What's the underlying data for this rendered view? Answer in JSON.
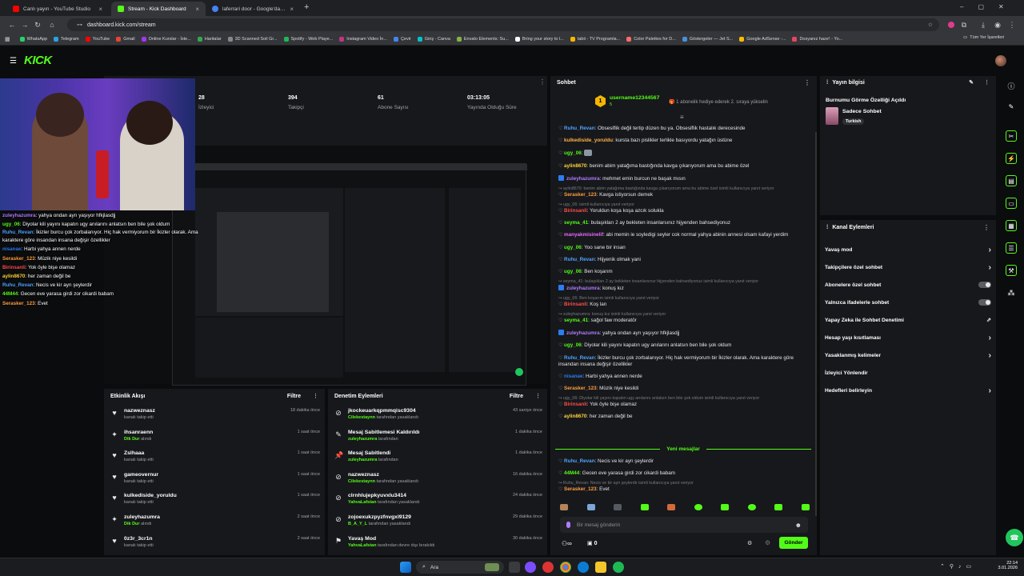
{
  "browser": {
    "tabs": [
      {
        "title": "Canlı yayın - YouTube Studio",
        "color": "#ff0000"
      },
      {
        "title": "Stream - Kick Dashboard",
        "color": "#53fc18"
      },
      {
        "title": "laferrari door - Google'da Ara",
        "color": "#4285f4"
      }
    ],
    "new_tab": "+",
    "url": "dashboard.kick.com/stream",
    "bookmarks": [
      {
        "label": "WhatsApp",
        "color": "#25d366"
      },
      {
        "label": "Telegram",
        "color": "#2aa3e0"
      },
      {
        "label": "YouTube",
        "color": "#ff0000"
      },
      {
        "label": "Gmail",
        "color": "#ea4335"
      },
      {
        "label": "Online Kurslar - İste...",
        "color": "#a435f0"
      },
      {
        "label": "Haritalar",
        "color": "#34a853"
      },
      {
        "label": "3D Scanned Soil Gr...",
        "color": "#888888"
      },
      {
        "label": "Spotify - Web Playe...",
        "color": "#1db954"
      },
      {
        "label": "Instagram Video İn...",
        "color": "#c13584"
      },
      {
        "label": "Çevir",
        "color": "#4285f4"
      },
      {
        "label": "Giriş - Canva",
        "color": "#00c4cc"
      },
      {
        "label": "Envato Elements: Su...",
        "color": "#82b541"
      },
      {
        "label": "Bring your story to l...",
        "color": "#ffffff"
      },
      {
        "label": "tabii - TV Programla...",
        "color": "#f5b700"
      },
      {
        "label": "Color Palettes for D...",
        "color": "#ff6b6b"
      },
      {
        "label": "Göstergeler — Jet S...",
        "color": "#4a90d9"
      },
      {
        "label": "Google AdSense -...",
        "color": "#fbbc05"
      },
      {
        "label": "Dosyanız hazır! - Yo...",
        "color": "#e94560"
      }
    ],
    "all_bookmarks": "Tüm Yer İşaretleri"
  },
  "kick": {
    "logo": "KICK"
  },
  "stats": [
    {
      "value": "28",
      "label": "İzleyici"
    },
    {
      "value": "394",
      "label": "Takipçi"
    },
    {
      "value": "61",
      "label": "Abone Sayısı"
    },
    {
      "value": "03:13:05",
      "label": "Yayında Olduğu Süre"
    }
  ],
  "overlay_chat": [
    {
      "user": "zuleyhazumra",
      "color": "#b07cff",
      "text": ": yahya ondan ayrı yaşıyor hfkjlasdjj"
    },
    {
      "user": "ugy_06",
      "color": "#53fc18",
      "text": ": Diyolar kili yayını kapatın ugy anılarını anlatsın ben bile şok oldum"
    },
    {
      "user": "Ruhu_Revan",
      "color": "#4fa3ff",
      "text": ": İkizler burcu çok zorbalanıyor. Hiç hak vermiyorum bir İkizler olarak. Ama karaktere göre insandan insana değişir özellikler"
    },
    {
      "user": "nisanae",
      "color": "#2a7df2",
      "text": ": Harbi yahya annen nerde"
    },
    {
      "user": "Serasker_123",
      "color": "#ff9f40",
      "text": ": Müzik niye kesildi"
    },
    {
      "user": "Birinsanli",
      "color": "#ff4d4d",
      "text": ": Yok öyle bişe olamaz"
    },
    {
      "user": "aylin8670",
      "color": "#ffd43b",
      "text": ": her zaman değil be"
    },
    {
      "user": "Ruhu_Revan",
      "color": "#4fa3ff",
      "text": ": Necis ve kir ayn şeylerdir"
    },
    {
      "user": "44M44",
      "color": "#53fc18",
      "text": ": Gecen eve yarasa girdi zor cikardi babam"
    },
    {
      "user": "Serasker_123",
      "color": "#ff9f40",
      "text": ": Evet"
    }
  ],
  "activity": {
    "title": "Etkinlik Akışı",
    "filter": "Filtre",
    "rows": [
      {
        "icon": "♥",
        "name": "nazweznasz",
        "sub": "kanalı takip etti",
        "time": "18 dakika önce",
        "icon_name": "heart-icon"
      },
      {
        "icon": "✦",
        "name": "ihsanraenn",
        "sub_hl": "Dik Dur",
        "sub": "alındı",
        "time": "1 saat önce",
        "icon_name": "reward-icon"
      },
      {
        "icon": "♥",
        "name": "Zslhaaa",
        "sub": "kanalı takip etti",
        "time": "1 saat önce",
        "icon_name": "heart-icon"
      },
      {
        "icon": "♥",
        "name": "gameovernur",
        "sub": "kanalı takip etti",
        "time": "1 saat önce",
        "icon_name": "heart-icon"
      },
      {
        "icon": "♥",
        "name": "kulkediside_yoruldu",
        "sub": "kanalı takip etti",
        "time": "1 saat önce",
        "icon_name": "heart-icon"
      },
      {
        "icon": "✦",
        "name": "zuleyhazumra",
        "sub_hl": "Dik Dur",
        "sub": "alındı",
        "time": "2 saat önce",
        "icon_name": "reward-icon"
      },
      {
        "icon": "♥",
        "name": "0z3r_3cr1n",
        "sub": "kanalı takip etti",
        "time": "2 saat önce",
        "icon_name": "heart-icon"
      }
    ]
  },
  "moderation": {
    "title": "Denetim Eylemleri",
    "filter": "Filtre",
    "rows": [
      {
        "icon": "⊘",
        "name": "jkockeuarkqpmmqisc9304",
        "sub_hl": "Cilekestaynn",
        "sub": "tarafından yasaklandı",
        "time": "43 saniye önce",
        "icon_name": "ban-icon"
      },
      {
        "icon": "✎",
        "name": "Mesaj Sabitlemesi Kaldırıldı",
        "sub_hl": "zuleyhazumra",
        "sub": "tarafından",
        "time": "1 dakika önce",
        "icon_name": "unpin-icon"
      },
      {
        "icon": "📌",
        "name": "Mesaj Sabitlendi",
        "sub_hl": "zuleyhazumra",
        "sub": "tarafından",
        "time": "1 dakika önce",
        "icon_name": "pin-icon"
      },
      {
        "icon": "⊘",
        "name": "nazweznasz",
        "sub_hl": "Cilekestaynn",
        "sub": "tarafından yasaklandı",
        "time": "16 dakika önce",
        "icon_name": "ban-icon"
      },
      {
        "icon": "⊘",
        "name": "clrnhlujepkyuvxlu3414",
        "sub_hl": "YahvaLafstan",
        "sub": "tarafından yasaklandı",
        "time": "24 dakika önce",
        "icon_name": "ban-icon"
      },
      {
        "icon": "⊘",
        "name": "zojoexukzpyzfnvgxl9129",
        "sub_hl": "B_A_Y_L",
        "sub": "tarafından yasaklandı",
        "time": "29 dakika önce",
        "icon_name": "ban-icon"
      },
      {
        "icon": "⚑",
        "name": "Yavaş Mod",
        "sub_hl": "YahvaLafstan",
        "sub": "tarafından devre dışı bırakıldı",
        "time": "30 dakika önce",
        "icon_name": "slow-mode-icon"
      }
    ]
  },
  "chat": {
    "title": "Sohbet",
    "gift_user": "username12344567",
    "gift_count": "5",
    "gift_text": "1 abonelik hediye ederek 2. sıraya yükselin",
    "new_messages": "Yeni mesajlar",
    "input_placeholder": "Bir mesaj gönderin",
    "points": "0",
    "send": "Gönder",
    "messages": [
      {
        "user": "Ruhu_Revan",
        "color": "#4fa3ff",
        "text": ": Obsesiflik değil tertip düzen bu ya. Obsesiflik hastalık derecesinde"
      },
      {
        "user": "kulkediside_yoruldu",
        "color": "#ffb347",
        "text": ": kursta bazı pislikler terlikle basıyordu yatağın üstüne"
      },
      {
        "user": "ugy_06",
        "color": "#53fc18",
        "text": ":",
        "emote": true
      },
      {
        "user": "aylin8670",
        "color": "#ffd43b",
        "text": ": benim abim yatağıma bastığında kavga çıkarıyorum ama bu abime özel"
      },
      {
        "user": "zuleyhazumra",
        "color": "#b07cff",
        "text": ": mehmet emin burcun ne başak mısın",
        "badge": true
      },
      {
        "reply": "aylin8670: benim abim yatağıma bastığında kavga çıkarıyorum ama bu abime özel isimli kullanıcıya yanıt veriyor",
        "user": "Serasker_123",
        "color": "#ff9f40",
        "text": ": Kavga istiyorsun demek"
      },
      {
        "reply": "ugy_06: isimli kullanıcıya yanıt veriyor",
        "user": "Birinsanli",
        "color": "#ff4d4d",
        "text": ": Yoruldun koşa koşa azcık solukla"
      },
      {
        "user": "seyma_41",
        "color": "#53fc18",
        "text": ": bulaşıkları 2 ay bekleten insanlarsınız hijyenden bahsediyonuz"
      },
      {
        "user": "manyakmisinelif",
        "color": "#e46aff",
        "text": ": abi memin ie soyledigi seyler cok normal yahya abinin annesi olsam kafayi yerdim"
      },
      {
        "user": "ugy_06",
        "color": "#53fc18",
        "text": ": Yoo sane bir insan"
      },
      {
        "user": "Ruhu_Revan",
        "color": "#4fa3ff",
        "text": ": Hijyenik olmak yani"
      },
      {
        "user": "ugy_06",
        "color": "#53fc18",
        "text": ": Ben koşarım"
      },
      {
        "reply": "seyma_41: bulaşıkları 2 ay bekleten insanlarsınız hijyenden bahsediyonuz isimli kullanıcıya yanıt veriyor",
        "user": "zuleyhazumra",
        "color": "#b07cff",
        "text": ": konuş kız",
        "badge": true
      },
      {
        "reply": "ugy_06: Ben koşarım isimli kullanıcıya yanıt veriyor",
        "user": "Birinsanli",
        "color": "#ff4d4d",
        "text": ": Koş lan"
      },
      {
        "reply": "zuleyhazumra: konuş kız isimli kullanıcıya yanıt veriyor",
        "user": "seyma_41",
        "color": "#53fc18",
        "text": ": sağol faw moderatör"
      },
      {
        "user": "zuleyhazumra",
        "color": "#b07cff",
        "text": ": yahya ondan ayrı yaşıyor hfkjlasdjj",
        "badge": true
      },
      {
        "user": "ugy_06",
        "color": "#53fc18",
        "text": ": Diyolar kili yayını kapatın ugy anılarını anlatsın ben bile şok oldum"
      },
      {
        "user": "Ruhu_Revan",
        "color": "#4fa3ff",
        "text": ": İkizler burcu çok zorbalanıyor. Hiç hak vermiyorum bir İkizler olarak. Ama karaktere göre insandan insana değişir özellikler"
      },
      {
        "user": "nisanae",
        "color": "#2a7df2",
        "text": ": Harbi yahya annen nerde"
      },
      {
        "user": "Serasker_123",
        "color": "#ff9f40",
        "text": ": Müzik niye kesildi"
      },
      {
        "reply": "ugy_06: Diyolar kili yayını kapatın ugy anılarını anlatsın ben bile şok oldum isimli kullanıcıya yanıt veriyor",
        "user": "Birinsanli",
        "color": "#ff4d4d",
        "text": ": Yok öyle bişe olamaz"
      },
      {
        "user": "aylin8670",
        "color": "#ffd43b",
        "text": ": her zaman değil be"
      }
    ],
    "after": [
      {
        "user": "Ruhu_Revan",
        "color": "#4fa3ff",
        "text": ": Necis ve kir ayn şeylerdir"
      },
      {
        "user": "44M44",
        "color": "#53fc18",
        "text": ": Gecen eve yarasa girdi zor cikardi babam"
      },
      {
        "reply": "Ruhu_Revan: Necis ve kir ayn şeylerdir isimli kullanıcıya yanıt veriyor",
        "user": "Serasker_123",
        "color": "#ff9f40",
        "text": ": Evet"
      }
    ]
  },
  "stream_info": {
    "title": "Yayın bilgisi",
    "stream_title": "Burnumu Görme Özelliği Açıldı",
    "category": "Sadece Sohbet",
    "tag": "Turkish"
  },
  "channel_actions": {
    "title": "Kanal Eylemleri",
    "items": [
      {
        "label": "Yavaş mod",
        "kind": "chevron",
        "name": "slow-mode"
      },
      {
        "label": "Takipçilere özel sohbet",
        "kind": "chevron",
        "name": "followers-only-chat"
      },
      {
        "label": "Abonelere özel sohbet",
        "kind": "toggle",
        "name": "subscribers-only-chat"
      },
      {
        "label": "Yalnızca ifadelerle sohbet",
        "kind": "toggle",
        "name": "emote-only-chat"
      },
      {
        "label": "Yapay Zeka ile Sohbet Denetimi",
        "kind": "link",
        "name": "ai-moderation"
      },
      {
        "label": "Hesap yaşı kısıtlaması",
        "kind": "chevron",
        "name": "account-age"
      },
      {
        "label": "Yasaklanmış kelimeler",
        "kind": "chevron",
        "name": "banned-words"
      },
      {
        "label": "İzleyici Yönlendir",
        "kind": "none",
        "name": "host-viewers"
      },
      {
        "label": "Hedefleri belirleyin",
        "kind": "chevron",
        "name": "set-goals"
      }
    ]
  },
  "taskbar": {
    "search": "Ara",
    "time": "22:14",
    "date": "3.01.2026"
  }
}
